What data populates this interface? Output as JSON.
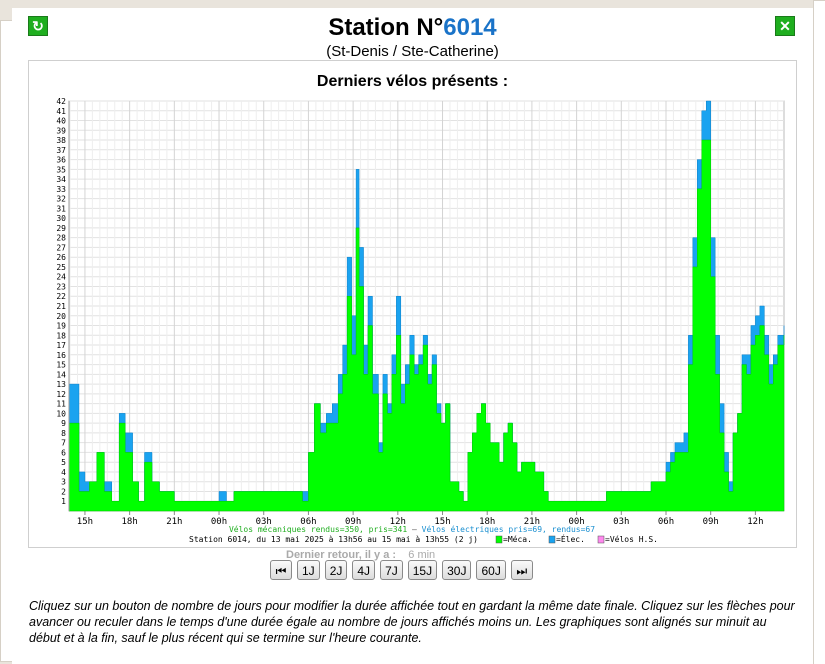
{
  "station": {
    "prefix": "Station N°",
    "number": "6014",
    "name": "(St-Denis / Ste-Catherine)"
  },
  "chart_heading": "Derniers vélos présents :",
  "colors": {
    "meca": "#00ff00",
    "elec": "#1aa3f0",
    "hs": "#ff88ee",
    "number": "#1a73c8"
  },
  "chart_data": {
    "type": "area",
    "ylim": [
      0,
      42
    ],
    "yticks": [
      "1",
      "2",
      "3",
      "4",
      "5",
      "6",
      "7",
      "8",
      "9",
      "10",
      "11",
      "12",
      "13",
      "14",
      "15",
      "16",
      "17",
      "18",
      "19",
      "20",
      "21",
      "22",
      "23",
      "24",
      "25",
      "26",
      "27",
      "28",
      "29",
      "30",
      "31",
      "32",
      "33",
      "34",
      "35",
      "36",
      "37",
      "38",
      "39",
      "40",
      "41",
      "42"
    ],
    "xlim": [
      13.93,
      61.92
    ],
    "xticks": [
      {
        "x": 15,
        "label": "15h"
      },
      {
        "x": 18,
        "label": "18h"
      },
      {
        "x": 21,
        "label": "21h"
      },
      {
        "x": 24,
        "label": "00h"
      },
      {
        "x": 27,
        "label": "03h"
      },
      {
        "x": 30,
        "label": "06h"
      },
      {
        "x": 33,
        "label": "09h"
      },
      {
        "x": 36,
        "label": "12h"
      },
      {
        "x": 39,
        "label": "15h"
      },
      {
        "x": 42,
        "label": "18h"
      },
      {
        "x": 45,
        "label": "21h"
      },
      {
        "x": 48,
        "label": "00h"
      },
      {
        "x": 51,
        "label": "03h"
      },
      {
        "x": 54,
        "label": "06h"
      },
      {
        "x": 57,
        "label": "09h"
      },
      {
        "x": 60,
        "label": "12h"
      }
    ],
    "x": [
      13.93,
      14.6,
      15.0,
      15.3,
      15.8,
      16.3,
      16.8,
      17.3,
      17.7,
      18.2,
      18.6,
      19.0,
      19.5,
      20.0,
      20.5,
      21.0,
      21.5,
      22.0,
      22.5,
      23.0,
      23.5,
      24.0,
      24.5,
      25.0,
      25.5,
      26.0,
      27.0,
      28.0,
      29.0,
      29.6,
      30.0,
      30.4,
      30.8,
      31.2,
      31.6,
      32.0,
      32.3,
      32.6,
      32.9,
      33.2,
      33.4,
      33.7,
      34.0,
      34.3,
      34.7,
      35.0,
      35.3,
      35.6,
      35.9,
      36.2,
      36.5,
      36.8,
      37.1,
      37.4,
      37.7,
      38.0,
      38.3,
      38.6,
      38.9,
      39.2,
      39.5,
      39.8,
      40.1,
      40.4,
      40.7,
      41.0,
      41.3,
      41.6,
      41.9,
      42.2,
      42.5,
      42.8,
      43.1,
      43.4,
      43.7,
      44.0,
      44.3,
      44.6,
      44.9,
      45.2,
      45.5,
      45.8,
      46.1,
      46.4,
      46.7,
      47.0,
      47.3,
      47.6,
      47.9,
      48.2,
      48.5,
      48.8,
      49.1,
      49.4,
      49.7,
      50.0,
      50.5,
      51.0,
      51.5,
      52.0,
      52.5,
      53.0,
      53.5,
      54.0,
      54.3,
      54.6,
      54.9,
      55.2,
      55.5,
      55.8,
      56.1,
      56.4,
      56.7,
      57.0,
      57.3,
      57.6,
      57.9,
      58.2,
      58.5,
      58.8,
      59.1,
      59.4,
      59.7,
      60.0,
      60.3,
      60.6,
      60.9,
      61.2,
      61.5,
      61.92
    ],
    "series": [
      {
        "name": "Méca.",
        "values": [
          9,
          2,
          2,
          3,
          6,
          2,
          1,
          9,
          6,
          3,
          1,
          5,
          3,
          2,
          2,
          1,
          1,
          1,
          1,
          1,
          1,
          1,
          1,
          2,
          2,
          2,
          2,
          2,
          2,
          1,
          6,
          11,
          8,
          9,
          9,
          12,
          14,
          22,
          16,
          29,
          23,
          14,
          19,
          12,
          6,
          12,
          10,
          14,
          18,
          11,
          13,
          16,
          14,
          15,
          17,
          13,
          15,
          10,
          9,
          11,
          3,
          3,
          2,
          1,
          6,
          8,
          10,
          11,
          9,
          7,
          7,
          5,
          8,
          9,
          7,
          4,
          5,
          5,
          5,
          4,
          4,
          2,
          1,
          1,
          1,
          1,
          1,
          1,
          1,
          1,
          1,
          1,
          1,
          1,
          1,
          2,
          2,
          2,
          2,
          2,
          2,
          3,
          3,
          4,
          5,
          6,
          6,
          6,
          15,
          25,
          33,
          38,
          38,
          24,
          14,
          8,
          4,
          2,
          8,
          10,
          15,
          14,
          17,
          18,
          19,
          16,
          13,
          15,
          17,
          18
        ]
      },
      {
        "name": "Élec.",
        "values": [
          4,
          2,
          1,
          0,
          0,
          1,
          0,
          1,
          2,
          0,
          0,
          1,
          0,
          0,
          0,
          0,
          0,
          0,
          0,
          0,
          0,
          1,
          0,
          0,
          0,
          0,
          0,
          0,
          0,
          1,
          0,
          0,
          1,
          1,
          2,
          2,
          3,
          4,
          4,
          6,
          4,
          3,
          3,
          2,
          1,
          2,
          1,
          2,
          4,
          2,
          2,
          2,
          1,
          1,
          1,
          1,
          1,
          1,
          0,
          0,
          0,
          0,
          0,
          0,
          0,
          0,
          0,
          0,
          0,
          0,
          0,
          0,
          0,
          0,
          0,
          0,
          0,
          0,
          0,
          0,
          0,
          0,
          0,
          0,
          0,
          0,
          0,
          0,
          0,
          0,
          0,
          0,
          0,
          0,
          0,
          0,
          0,
          0,
          0,
          0,
          0,
          0,
          0,
          1,
          1,
          1,
          1,
          2,
          3,
          3,
          3,
          3,
          4,
          4,
          4,
          3,
          2,
          1,
          0,
          0,
          1,
          2,
          2,
          2,
          2,
          2,
          2,
          1,
          1,
          1
        ]
      },
      {
        "name": "Vélos H.S.",
        "values": [
          0,
          0,
          0,
          0,
          0,
          0,
          0,
          0,
          0,
          0,
          0,
          0,
          0,
          0,
          0,
          0,
          0,
          0,
          0,
          0,
          0,
          0,
          0,
          0,
          0,
          0,
          0,
          0,
          0,
          0,
          0,
          0,
          0,
          0,
          0,
          0,
          0,
          0,
          0,
          0,
          0,
          0,
          0,
          0,
          0,
          0,
          0,
          0,
          0,
          0,
          0,
          0,
          0,
          0,
          0,
          0,
          0,
          0,
          0,
          0,
          0,
          0,
          0,
          0,
          0,
          0,
          0,
          0,
          0,
          0,
          0,
          0,
          0,
          0,
          0,
          0,
          0,
          0,
          0,
          0,
          0,
          0,
          0,
          0,
          0,
          0,
          0,
          0,
          0,
          0,
          0,
          0,
          0,
          0,
          0,
          0,
          0,
          0,
          0,
          0,
          0,
          0,
          0,
          0,
          0,
          0,
          0,
          0,
          0,
          0,
          0,
          0,
          0,
          0,
          0,
          0,
          0,
          0,
          0,
          0,
          0,
          0,
          0,
          0,
          0,
          0,
          0,
          0,
          0,
          0
        ]
      }
    ],
    "stats_line": {
      "meca": "Vélos mécaniques rendus=350, pris=341",
      "sep": " – ",
      "elec": "Vélos électriques pris=69, rendus=67"
    },
    "period_line": "Station 6014, du 13 mai 2025 à 13h56 au 15 mai à 13h55 (2 j)",
    "legend": [
      {
        "label": "=Méca."
      },
      {
        "label": "=Élec."
      },
      {
        "label": "=Vélos H.S."
      }
    ]
  },
  "last_return": {
    "label": "Dernier retour, il y a :",
    "value": "6 min"
  },
  "nav": {
    "first": "⏮",
    "b1": "1J",
    "b2": "2J",
    "b4": "4J",
    "b7": "7J",
    "b15": "15J",
    "b30": "30J",
    "b60": "60J",
    "last": "⏭"
  },
  "help_text": "Cliquez sur un bouton de nombre de jours pour modifier la durée affichée tout en gardant la même date finale. Cliquez sur les flèches pour avancer ou reculer dans le temps d'une durée égale au nombre de jours affichés moins un. Les graphiques sont alignés sur minuit au début et à la fin, sauf le plus récent qui se termine sur l'heure courante.",
  "icons": {
    "refresh": "refresh-icon",
    "close": "close-icon"
  },
  "icon_glyphs": {
    "refresh": "↻",
    "close": "✕"
  }
}
